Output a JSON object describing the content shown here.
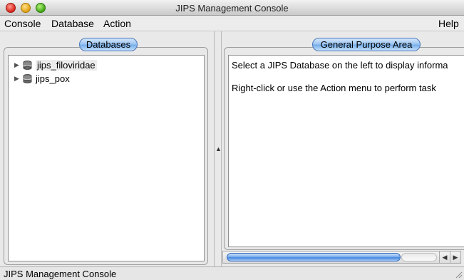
{
  "window": {
    "title": "JIPS Management Console"
  },
  "menubar": {
    "items": [
      "Console",
      "Database",
      "Action"
    ],
    "help": "Help"
  },
  "databases_panel": {
    "title": "Databases",
    "items": [
      {
        "label": "jips_filoviridae",
        "icon": "database-icon"
      },
      {
        "label": "jips_pox",
        "icon": "database-icon"
      }
    ]
  },
  "general_panel": {
    "title": "General Purpose Area",
    "lines": [
      "Select a JIPS Database on the left to display informa",
      "Right-click or use the Action menu to perform task"
    ]
  },
  "statusbar": {
    "text": "JIPS Management Console"
  },
  "colors": {
    "accent": "#76aeea",
    "close": "#d9251b",
    "minimize": "#e0a011",
    "maximize": "#3ea514"
  }
}
